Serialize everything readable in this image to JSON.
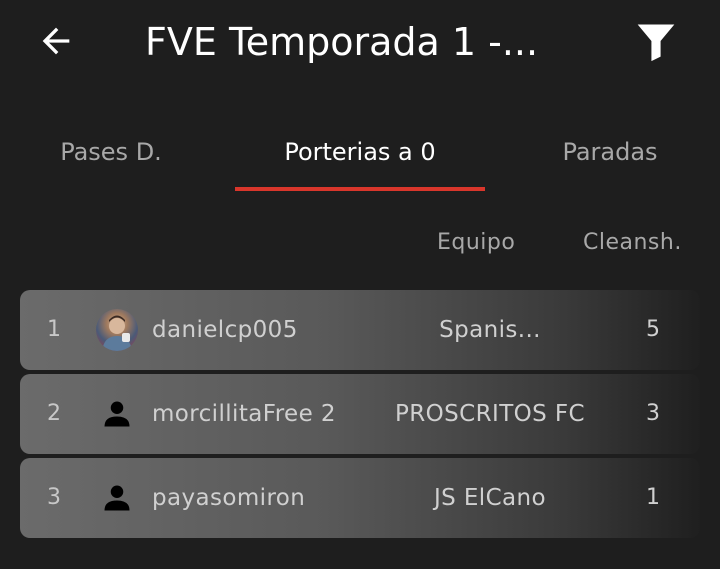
{
  "header": {
    "title": "FVE Temporada 1 -...",
    "back_icon": "arrow-left-icon",
    "filter_icon": "filter-funnel-icon"
  },
  "tabs": [
    {
      "label": "Pases D.",
      "active": false
    },
    {
      "label": "Porterias a 0",
      "active": true
    },
    {
      "label": "Paradas",
      "active": false
    }
  ],
  "columns": {
    "team": "Equipo",
    "cleansheets": "Cleansh."
  },
  "rows": [
    {
      "rank": "1",
      "player": "danielcp005",
      "team": "Spanis...",
      "value": "5",
      "avatar": "photo"
    },
    {
      "rank": "2",
      "player": "morcillitaFree 2",
      "team": "PROSCRITOS FC",
      "value": "3",
      "avatar": "person-icon"
    },
    {
      "rank": "3",
      "player": "payasomiron",
      "team": "JS ElCano",
      "value": "1",
      "avatar": "person-icon"
    }
  ],
  "colors": {
    "background": "#1e1e1e",
    "accent": "#d9362b",
    "row": "#6b6b6b"
  }
}
